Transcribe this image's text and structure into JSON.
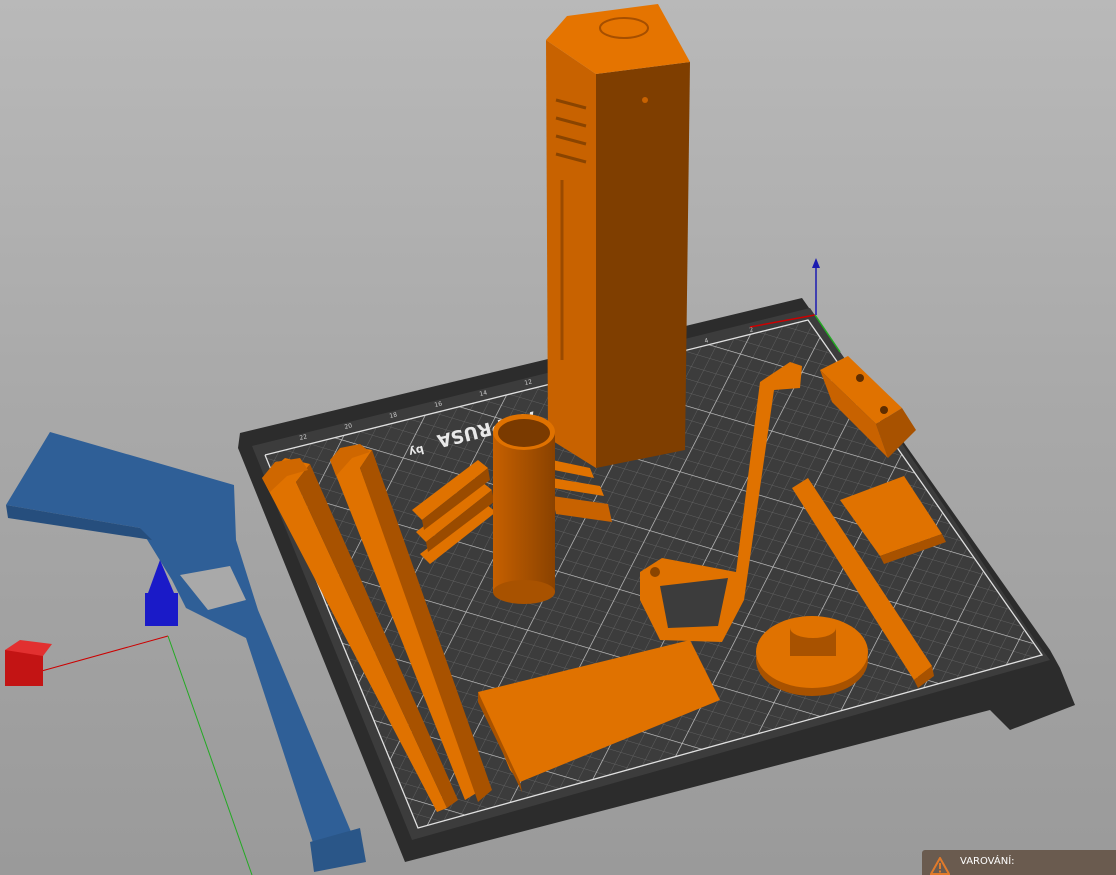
{
  "viewport": {
    "background_top": "#b9b9b9",
    "background_bottom": "#9a9a9a",
    "model_color": "#d36a00",
    "selected_model_color": "#2f5f97"
  },
  "bed": {
    "label_main": "AL PRUSA",
    "label_sub": "by"
  },
  "axes": {
    "x_color": "#cc0000",
    "y_color": "#00aa00",
    "z_color": "#0000cc"
  },
  "notification": {
    "label": "VAROVÁNÍ:",
    "icon": "warning-icon",
    "accent": "#e07a2a"
  }
}
